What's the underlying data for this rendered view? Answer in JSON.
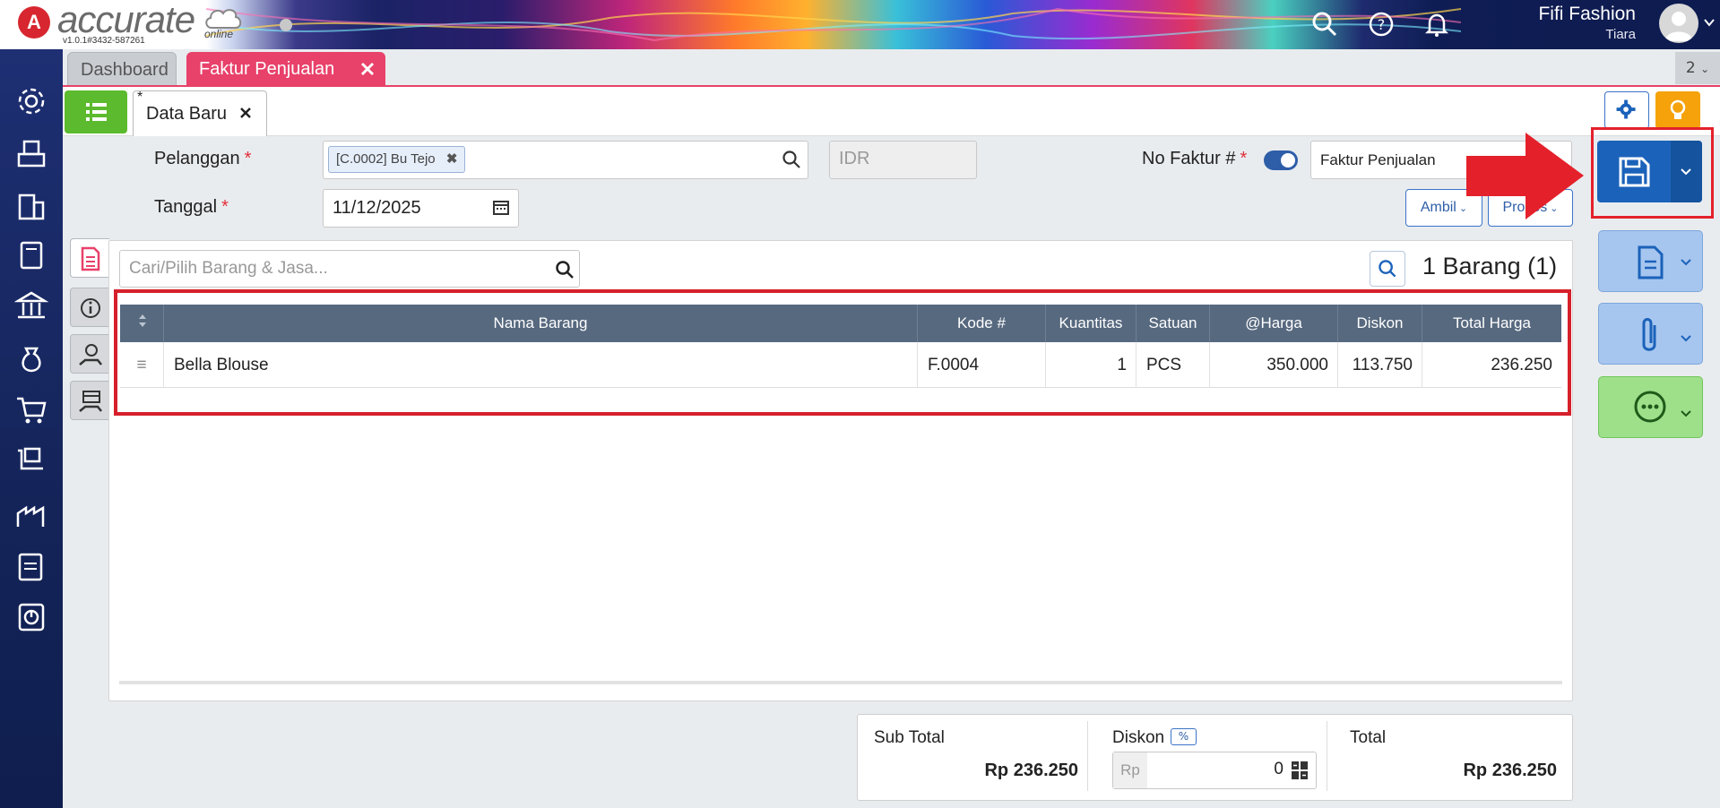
{
  "app": {
    "logo_letter": "A",
    "logo_text": "accurate",
    "logo_sub": "online",
    "version": "v1.0.1#3432-587261",
    "user_name": "Fifi Fashion",
    "user_sub": "Tiara"
  },
  "tabs": [
    {
      "label": "Dashboard"
    },
    {
      "label": "Faktur Penjualan"
    }
  ],
  "tab_count": "2",
  "subtab": {
    "marker": "*",
    "label": "Data Baru"
  },
  "form": {
    "pelanggan_label": "Pelanggan",
    "pelanggan_value": "[C.0002] Bu Tejo",
    "currency_placeholder": "IDR",
    "tanggal_label": "Tanggal",
    "tanggal_value": "11/12/2025",
    "no_faktur_label": "No Faktur #",
    "no_faktur_value": "Faktur Penjualan",
    "required_mark": "*",
    "ambil_label": "Ambil",
    "proses_label": "Proses"
  },
  "items": {
    "search_placeholder": "Cari/Pilih Barang & Jasa...",
    "count_label": "1 Barang (1)",
    "columns": [
      "Nama Barang",
      "Kode #",
      "Kuantitas",
      "Satuan",
      "@Harga",
      "Diskon",
      "Total Harga"
    ],
    "rows": [
      {
        "nama": "Bella Blouse",
        "kode": "F.0004",
        "qty": "1",
        "satuan": "PCS",
        "harga": "350.000",
        "diskon": "113.750",
        "total": "236.250"
      }
    ]
  },
  "totals": {
    "sub_total_label": "Sub Total",
    "sub_total_value": "Rp 236.250",
    "diskon_label": "Diskon",
    "diskon_badge": "%",
    "diskon_prefix": "Rp",
    "diskon_value": "0",
    "total_label": "Total",
    "total_value": "Rp 236.250"
  },
  "colors": {
    "accent_pink": "#e8416a",
    "save_blue": "#1b62ba",
    "highlight_red": "#e4212b",
    "table_header": "#57697f"
  }
}
